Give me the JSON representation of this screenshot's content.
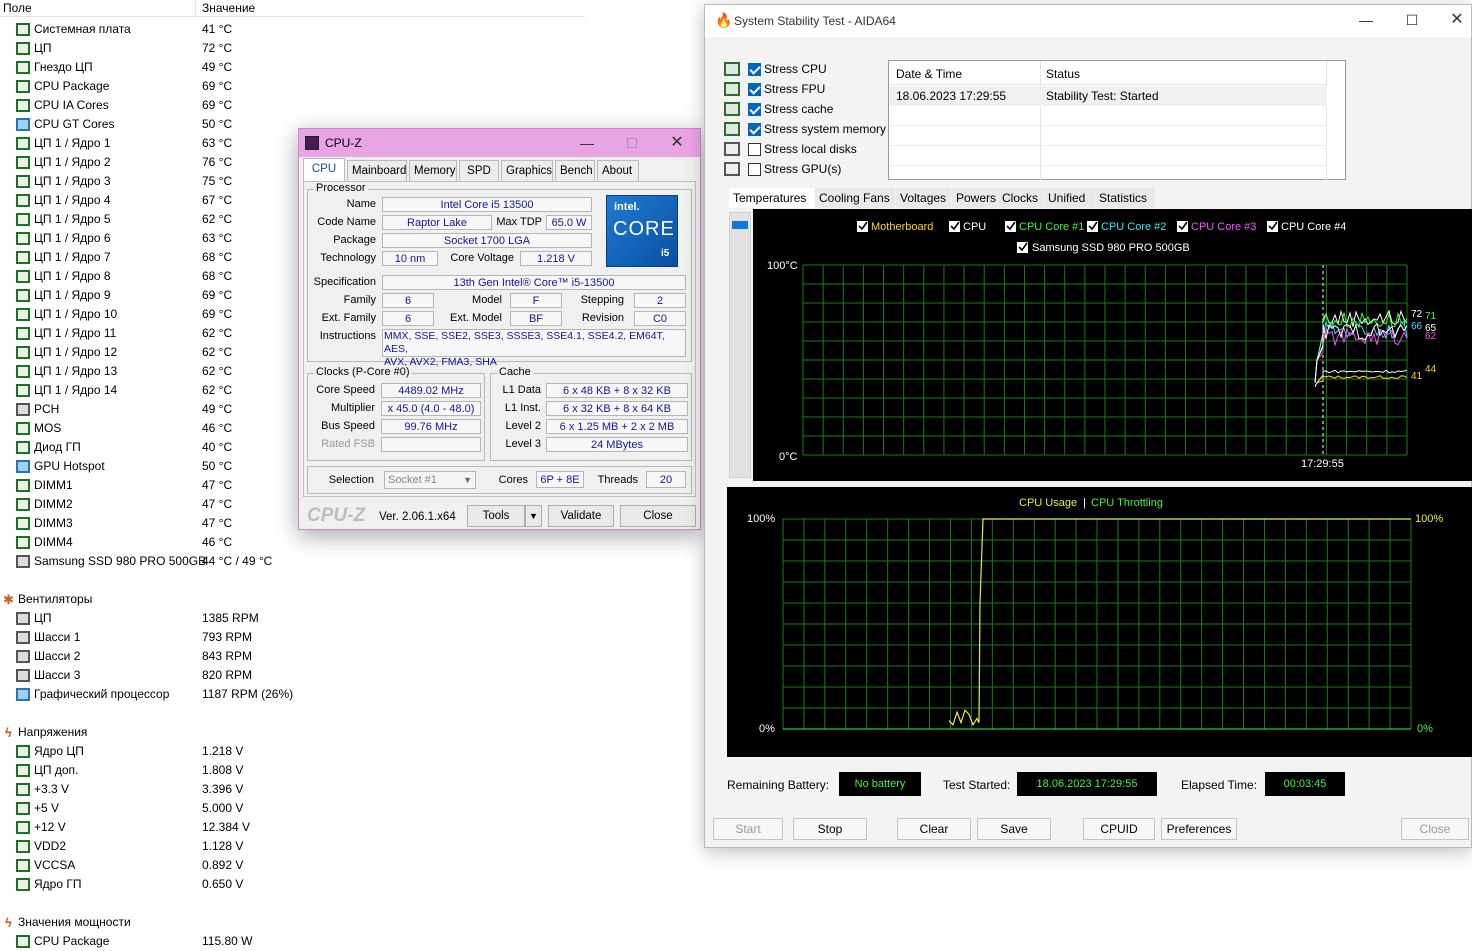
{
  "header": {
    "col1": "Поле",
    "col2": "Значение"
  },
  "temp_rows": [
    {
      "label": "Системная плата",
      "value": "41 °C"
    },
    {
      "label": "ЦП",
      "value": "72 °C"
    },
    {
      "label": "Гнездо ЦП",
      "value": "49 °C"
    },
    {
      "label": "CPU Package",
      "value": "69 °C"
    },
    {
      "label": "CPU IA Cores",
      "value": "69 °C"
    },
    {
      "label": "CPU GT Cores",
      "value": "50 °C"
    },
    {
      "label": "ЦП 1 / Ядро 1",
      "value": "63 °C"
    },
    {
      "label": "ЦП 1 / Ядро 2",
      "value": "76 °C"
    },
    {
      "label": "ЦП 1 / Ядро 3",
      "value": "75 °C"
    },
    {
      "label": "ЦП 1 / Ядро 4",
      "value": "67 °C"
    },
    {
      "label": "ЦП 1 / Ядро 5",
      "value": "62 °C"
    },
    {
      "label": "ЦП 1 / Ядро 6",
      "value": "63 °C"
    },
    {
      "label": "ЦП 1 / Ядро 7",
      "value": "68 °C"
    },
    {
      "label": "ЦП 1 / Ядро 8",
      "value": "68 °C"
    },
    {
      "label": "ЦП 1 / Ядро 9",
      "value": "69 °C"
    },
    {
      "label": "ЦП 1 / Ядро 10",
      "value": "69 °C"
    },
    {
      "label": "ЦП 1 / Ядро 11",
      "value": "62 °C"
    },
    {
      "label": "ЦП 1 / Ядро 12",
      "value": "62 °C"
    },
    {
      "label": "ЦП 1 / Ядро 13",
      "value": "62 °C"
    },
    {
      "label": "ЦП 1 / Ядро 14",
      "value": "62 °C"
    },
    {
      "label": "PCH",
      "value": "49 °C"
    },
    {
      "label": "MOS",
      "value": "46 °C"
    },
    {
      "label": "Диод ГП",
      "value": "40 °C"
    },
    {
      "label": "GPU Hotspot",
      "value": "50 °C"
    },
    {
      "label": "DIMM1",
      "value": "47 °C"
    },
    {
      "label": "DIMM2",
      "value": "47 °C"
    },
    {
      "label": "DIMM3",
      "value": "47 °C"
    },
    {
      "label": "DIMM4",
      "value": "46 °C"
    },
    {
      "label": "Samsung SSD 980 PRO 500GB",
      "value": "44 °C / 49 °C"
    }
  ],
  "fans_group": "Вентиляторы",
  "fan_rows": [
    {
      "label": "ЦП",
      "value": "1385 RPM"
    },
    {
      "label": "Шасси 1",
      "value": "793 RPM"
    },
    {
      "label": "Шасси 2",
      "value": "843 RPM"
    },
    {
      "label": "Шасси 3",
      "value": "820 RPM"
    },
    {
      "label": "Графический процессор",
      "value": "1187 RPM  (26%)"
    }
  ],
  "volt_group": "Напряжения",
  "volt_rows": [
    {
      "label": "Ядро ЦП",
      "value": "1.218 V"
    },
    {
      "label": "ЦП доп.",
      "value": "1.808 V"
    },
    {
      "label": "+3.3 V",
      "value": "3.396 V"
    },
    {
      "label": "+5 V",
      "value": "5.000 V"
    },
    {
      "label": "+12 V",
      "value": "12.384 V"
    },
    {
      "label": "VDD2",
      "value": "1.128 V"
    },
    {
      "label": "VCCSA",
      "value": "0.892 V"
    },
    {
      "label": "Ядро ГП",
      "value": "0.650 V"
    }
  ],
  "power_group": "Значения мощности",
  "power_rows": [
    {
      "label": "CPU Package",
      "value": "115.80 W"
    }
  ],
  "cpuz": {
    "title": "CPU-Z",
    "tabs": [
      "CPU",
      "Mainboard",
      "Memory",
      "SPD",
      "Graphics",
      "Bench",
      "About"
    ],
    "processor_legend": "Processor",
    "name_label": "Name",
    "name": "Intel Core i5 13500",
    "codename_label": "Code Name",
    "codename": "Raptor Lake",
    "maxtdp_label": "Max TDP",
    "maxtdp": "65.0 W",
    "package_label": "Package",
    "package": "Socket 1700 LGA",
    "tech_label": "Technology",
    "tech": "10 nm",
    "voltage_label": "Core Voltage",
    "voltage": "1.218 V",
    "spec_label": "Specification",
    "spec": "13th Gen Intel® Core™ i5-13500",
    "family_label": "Family",
    "family": "6",
    "model_label": "Model",
    "model": "F",
    "stepping_label": "Stepping",
    "stepping": "2",
    "extfamily_label": "Ext. Family",
    "extfamily": "6",
    "extmodel_label": "Ext. Model",
    "extmodel": "BF",
    "revision_label": "Revision",
    "revision": "C0",
    "instr_label": "Instructions",
    "instr1": "MMX, SSE, SSE2, SSE3, SSSE3, SSE4.1, SSE4.2, EM64T, AES,",
    "instr2": "AVX, AVX2, FMA3, SHA",
    "logo_brand": "intel.",
    "logo_core": "CORE",
    "logo_tier": "i5",
    "clocks_legend": "Clocks (P-Core #0)",
    "corespeed_label": "Core Speed",
    "corespeed": "4489.02 MHz",
    "mult_label": "Multiplier",
    "mult": "x 45.0 (4.0 - 48.0)",
    "bus_label": "Bus Speed",
    "bus": "99.76 MHz",
    "fsb_label": "Rated FSB",
    "fsb": "",
    "cache_legend": "Cache",
    "l1d_label": "L1 Data",
    "l1d": "6 x 48 KB + 8 x 32 KB",
    "l1i_label": "L1 Inst.",
    "l1i": "6 x 32 KB + 8 x 64 KB",
    "l2_label": "Level 2",
    "l2": "6 x 1.25 MB + 2 x 2 MB",
    "l3_label": "Level 3",
    "l3": "24 MBytes",
    "selection_label": "Selection",
    "selection": "Socket #1",
    "cores_label": "Cores",
    "cores": "6P + 8E",
    "threads_label": "Threads",
    "threads": "20",
    "brand": "CPU-Z",
    "version": "Ver. 2.06.1.x64",
    "tools": "Tools",
    "validate": "Validate",
    "close": "Close"
  },
  "aida": {
    "title": "System Stability Test - AIDA64",
    "stress": [
      {
        "label": "Stress CPU",
        "checked": true
      },
      {
        "label": "Stress FPU",
        "checked": true
      },
      {
        "label": "Stress cache",
        "checked": true
      },
      {
        "label": "Stress system memory",
        "checked": true
      },
      {
        "label": "Stress local disks",
        "checked": false
      },
      {
        "label": "Stress GPU(s)",
        "checked": false
      }
    ],
    "log_headers": [
      "Date & Time",
      "Status"
    ],
    "log_row": [
      "18.06.2023 17:29:55",
      "Stability Test: Started"
    ],
    "tabs": [
      "Temperatures",
      "Cooling Fans",
      "Voltages",
      "Powers",
      "Clocks",
      "Unified",
      "Statistics"
    ],
    "legend1": [
      {
        "label": "Motherboard",
        "color": "#ffd21e"
      },
      {
        "label": "CPU",
        "color": "#ffffff"
      },
      {
        "label": "CPU Core #1",
        "color": "#3cf53c"
      },
      {
        "label": "CPU Core #2",
        "color": "#35e6ff"
      },
      {
        "label": "CPU Core #3",
        "color": "#ff4dff"
      },
      {
        "label": "CPU Core #4",
        "color": "#ffffff"
      }
    ],
    "legend2": "Samsung SSD 980 PRO 500GB",
    "temp_top": "100°C",
    "temp_bottom": "0°C",
    "temp_time": "17:29:55",
    "end_labels": [
      "72",
      "71",
      "66",
      "65",
      "62",
      "44",
      "41"
    ],
    "usage_title": "CPU Usage",
    "usage_sep": "|",
    "throttle_title": "CPU Throttling",
    "usage_left_top": "100%",
    "usage_left_bottom": "0%",
    "usage_right_top": "100%",
    "usage_right_bottom": "0%",
    "battery_label": "Remaining Battery:",
    "battery": "No battery",
    "started_label": "Test Started:",
    "started": "18.06.2023 17:29:55",
    "elapsed_label": "Elapsed Time:",
    "elapsed": "00:03:45",
    "buttons": [
      "Start",
      "Stop",
      "Clear",
      "Save",
      "CPUID",
      "Preferences",
      "Close"
    ]
  },
  "chart_data": [
    {
      "type": "line",
      "legend": [
        "Motherboard",
        "CPU",
        "CPU Core #1",
        "CPU Core #2",
        "CPU Core #3",
        "CPU Core #4",
        "Samsung SSD 980 PRO 500GB"
      ],
      "ylim": [
        0,
        100
      ],
      "ylabel_top": "100°C",
      "ylabel_bottom": "0°C",
      "x_tick": "17:29:55",
      "series": [
        {
          "name": "Motherboard",
          "color": "#ffd21e",
          "end_value": 41
        },
        {
          "name": "Samsung SSD 980 PRO 500GB",
          "color": "#ffffff",
          "end_value": 44
        },
        {
          "name": "CPU",
          "color": "#ffffff",
          "end_value": 72
        },
        {
          "name": "CPU Core #1",
          "color": "#3cf53c",
          "end_value": 71
        },
        {
          "name": "CPU Core #2",
          "color": "#35e6ff",
          "end_value": 66
        },
        {
          "name": "CPU Core #3",
          "color": "#ff4dff",
          "end_value": 62
        },
        {
          "name": "CPU Core #4",
          "color": "#ffffff",
          "end_value": 65
        }
      ]
    },
    {
      "type": "line",
      "legend": [
        "CPU Usage",
        "CPU Throttling"
      ],
      "ylim": [
        0,
        100
      ],
      "series": [
        {
          "name": "CPU Usage",
          "color": "#e8f03c",
          "end_value": 100
        },
        {
          "name": "CPU Throttling",
          "color": "#3cf53c",
          "end_value": 0
        }
      ]
    }
  ]
}
